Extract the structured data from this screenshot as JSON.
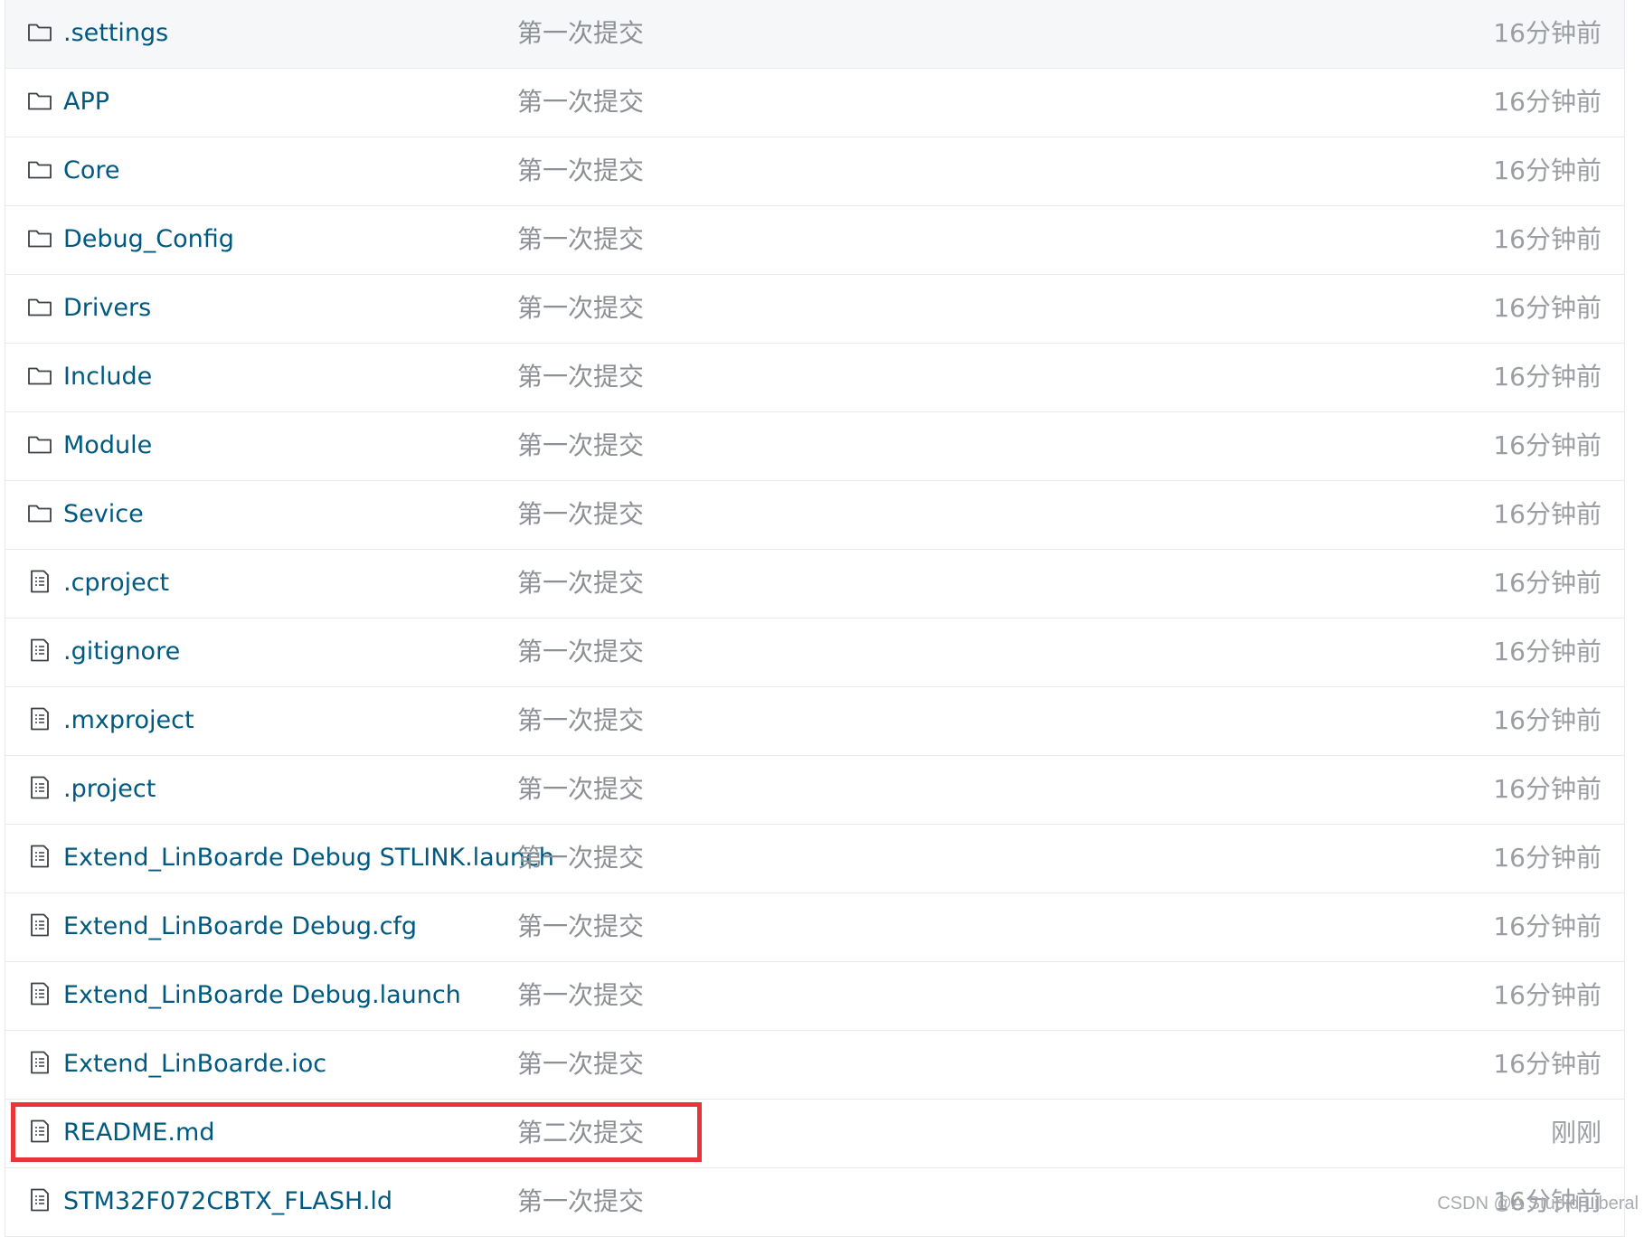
{
  "files": [
    {
      "type": "folder",
      "name": ".settings",
      "commit": "第一次提交",
      "time": "16分钟前"
    },
    {
      "type": "folder",
      "name": "APP",
      "commit": "第一次提交",
      "time": "16分钟前"
    },
    {
      "type": "folder",
      "name": "Core",
      "commit": "第一次提交",
      "time": "16分钟前"
    },
    {
      "type": "folder",
      "name": "Debug_Config",
      "commit": "第一次提交",
      "time": "16分钟前"
    },
    {
      "type": "folder",
      "name": "Drivers",
      "commit": "第一次提交",
      "time": "16分钟前"
    },
    {
      "type": "folder",
      "name": "Include",
      "commit": "第一次提交",
      "time": "16分钟前"
    },
    {
      "type": "folder",
      "name": "Module",
      "commit": "第一次提交",
      "time": "16分钟前"
    },
    {
      "type": "folder",
      "name": "Sevice",
      "commit": "第一次提交",
      "time": "16分钟前"
    },
    {
      "type": "file",
      "name": ".cproject",
      "commit": "第一次提交",
      "time": "16分钟前"
    },
    {
      "type": "file",
      "name": ".gitignore",
      "commit": "第一次提交",
      "time": "16分钟前"
    },
    {
      "type": "file",
      "name": ".mxproject",
      "commit": "第一次提交",
      "time": "16分钟前"
    },
    {
      "type": "file",
      "name": ".project",
      "commit": "第一次提交",
      "time": "16分钟前"
    },
    {
      "type": "file",
      "name": "Extend_LinBoarde Debug STLINK.launch",
      "commit": "第一次提交",
      "time": "16分钟前"
    },
    {
      "type": "file",
      "name": "Extend_LinBoarde Debug.cfg",
      "commit": "第一次提交",
      "time": "16分钟前"
    },
    {
      "type": "file",
      "name": "Extend_LinBoarde Debug.launch",
      "commit": "第一次提交",
      "time": "16分钟前"
    },
    {
      "type": "file",
      "name": "Extend_LinBoarde.ioc",
      "commit": "第一次提交",
      "time": "16分钟前"
    },
    {
      "type": "file",
      "name": "README.md",
      "commit": "第二次提交",
      "time": "刚刚",
      "highlighted": true
    },
    {
      "type": "file",
      "name": "STM32F072CBTX_FLASH.ld",
      "commit": "第一次提交",
      "time": "16分钟前"
    }
  ],
  "watermark": "CSDN @A Stupid Liberal",
  "colors": {
    "link": "#005980",
    "muted": "#8c8f94",
    "highlight": "#e8343b",
    "row_border": "#e9ebee"
  }
}
